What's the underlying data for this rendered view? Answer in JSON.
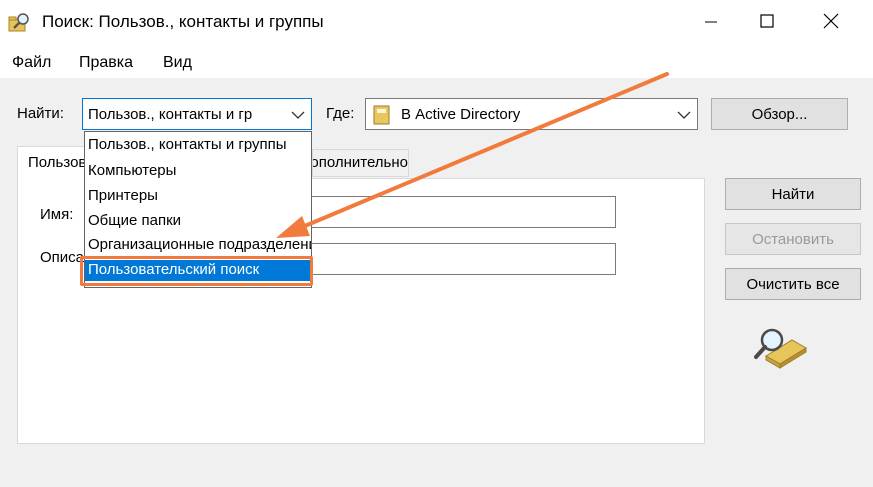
{
  "window": {
    "title": "Поиск: Пользов., контакты и группы",
    "icon": "search-folder-icon",
    "controls": [
      "minimize-icon",
      "maximize-icon",
      "close-icon"
    ]
  },
  "menu": {
    "file": "Файл",
    "edit": "Правка",
    "view": "Вид"
  },
  "find_row": {
    "find_label": "Найти:",
    "find_value": "Пользов., контакты и гр",
    "where_label": "Где:",
    "where_value": "В Active Directory",
    "browse_button": "Обзор..."
  },
  "dropdown": {
    "options": [
      "Пользов., контакты и группы",
      "Компьютеры",
      "Принтеры",
      "Общие папки",
      "Организационные подразделения",
      "Пользовательский поиск"
    ],
    "selected": "Пользовательский поиск"
  },
  "tabs": {
    "first": "Пользователи, контакты и группы",
    "second": "Дополнительно"
  },
  "form": {
    "name_label": "Имя:",
    "description_label": "Описание:"
  },
  "actions": {
    "find_now": "Найти",
    "stop": "Остановить",
    "clear_all": "Очистить все"
  },
  "annotation": {
    "arrow_color": "#f07b3c",
    "highlight_color": "#f07b3c"
  },
  "colors": {
    "selection": "#0078d7",
    "window_bg": "#f0f0f0"
  }
}
